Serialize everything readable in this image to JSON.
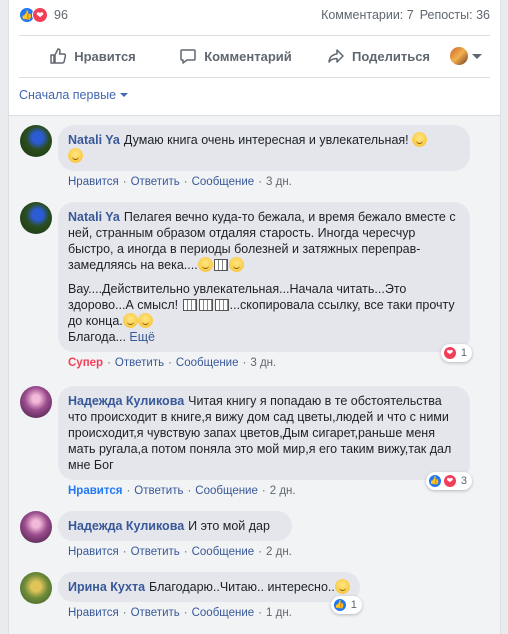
{
  "post": {
    "reaction_count": "96",
    "comments_label": "Комментарии: 7",
    "shares_label": "Репосты: 36"
  },
  "actions": {
    "like": "Нравится",
    "comment": "Комментарий",
    "share": "Поделиться"
  },
  "sort": {
    "label": "Сначала первые"
  },
  "colors": {
    "accent": "#385898",
    "like_blue": "#2078f4",
    "love_red": "#f33e58",
    "bubble": "#e4e6eb"
  },
  "comments": [
    {
      "author": "Natali Ya",
      "text": "Думаю книга очень интересная и увлекательная!",
      "like": "Нравится",
      "reply": "Ответить",
      "message": "Сообщение",
      "time": "3 дн."
    },
    {
      "author": "Natali Ya",
      "text": "Пелагея вечно куда-то бежала, и время бежало вместе с ней, странным образом отдаляя старость. Иногда чересчур быстро, а иногда в периоды болезней и затяжных переправ- замедляясь на века....",
      "text2": "Вау....Действительно увлекательная...Начала читать...Это здорово...А смысл!",
      "text3": "...скопировала ссылку, все таки прочту до конца.",
      "text4": "Благода...",
      "more": "Ещё",
      "like": "Супер",
      "reply": "Ответить",
      "message": "Сообщение",
      "time": "3 дн.",
      "reactions": "1"
    },
    {
      "author": "Надежда Куликова",
      "text": "Читая книгу я попадаю в те обстоятельства что происходит в книге,я вижу дом сад цветы,людей и что с ними происходит,я чувствую запах цветов,Дым сигарет,раньше меня мать ругала,а потом поняла это мой мир,я его таким вижу,так дал мне Бог",
      "like": "Нравится",
      "reply": "Ответить",
      "message": "Сообщение",
      "time": "2 дн.",
      "reactions": "3"
    },
    {
      "author": "Надежда Куликова",
      "text": "И это мой дар",
      "like": "Нравится",
      "reply": "Ответить",
      "message": "Сообщение",
      "time": "2 дн."
    },
    {
      "author": "Ирина Кухта",
      "text": "Благодарю..Читаю.. интересно..",
      "like": "Нравится",
      "reply": "Ответить",
      "message": "Сообщение",
      "time": "1 дн.",
      "reactions": "1"
    }
  ]
}
